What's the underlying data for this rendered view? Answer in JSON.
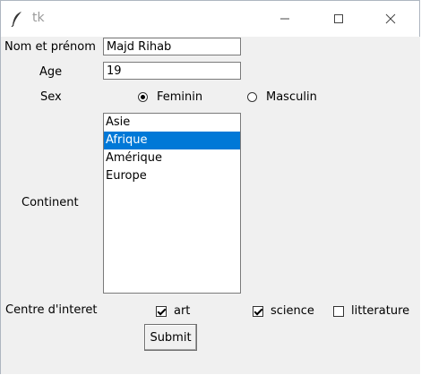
{
  "window": {
    "title": "tk"
  },
  "form": {
    "name_label": "Nom et prénom",
    "name_value": "Majd Rihab",
    "age_label": "Age",
    "age_value": "19",
    "sex_label": "Sex",
    "sex_options": [
      "Feminin",
      "Masculin"
    ],
    "sex_selected": "Feminin",
    "continent_label": "Continent",
    "continents": [
      "Asie",
      "Afrique",
      "Amérique",
      "Europe"
    ],
    "continent_selected": "Afrique",
    "interest_label": "Centre d'interet",
    "interests": [
      {
        "label": "art",
        "checked": true
      },
      {
        "label": "science",
        "checked": true
      },
      {
        "label": "litterature",
        "checked": false
      }
    ],
    "submit_label": "Submit"
  },
  "colors": {
    "selection": "#0078d7",
    "window_bg": "#f0f0f0"
  }
}
